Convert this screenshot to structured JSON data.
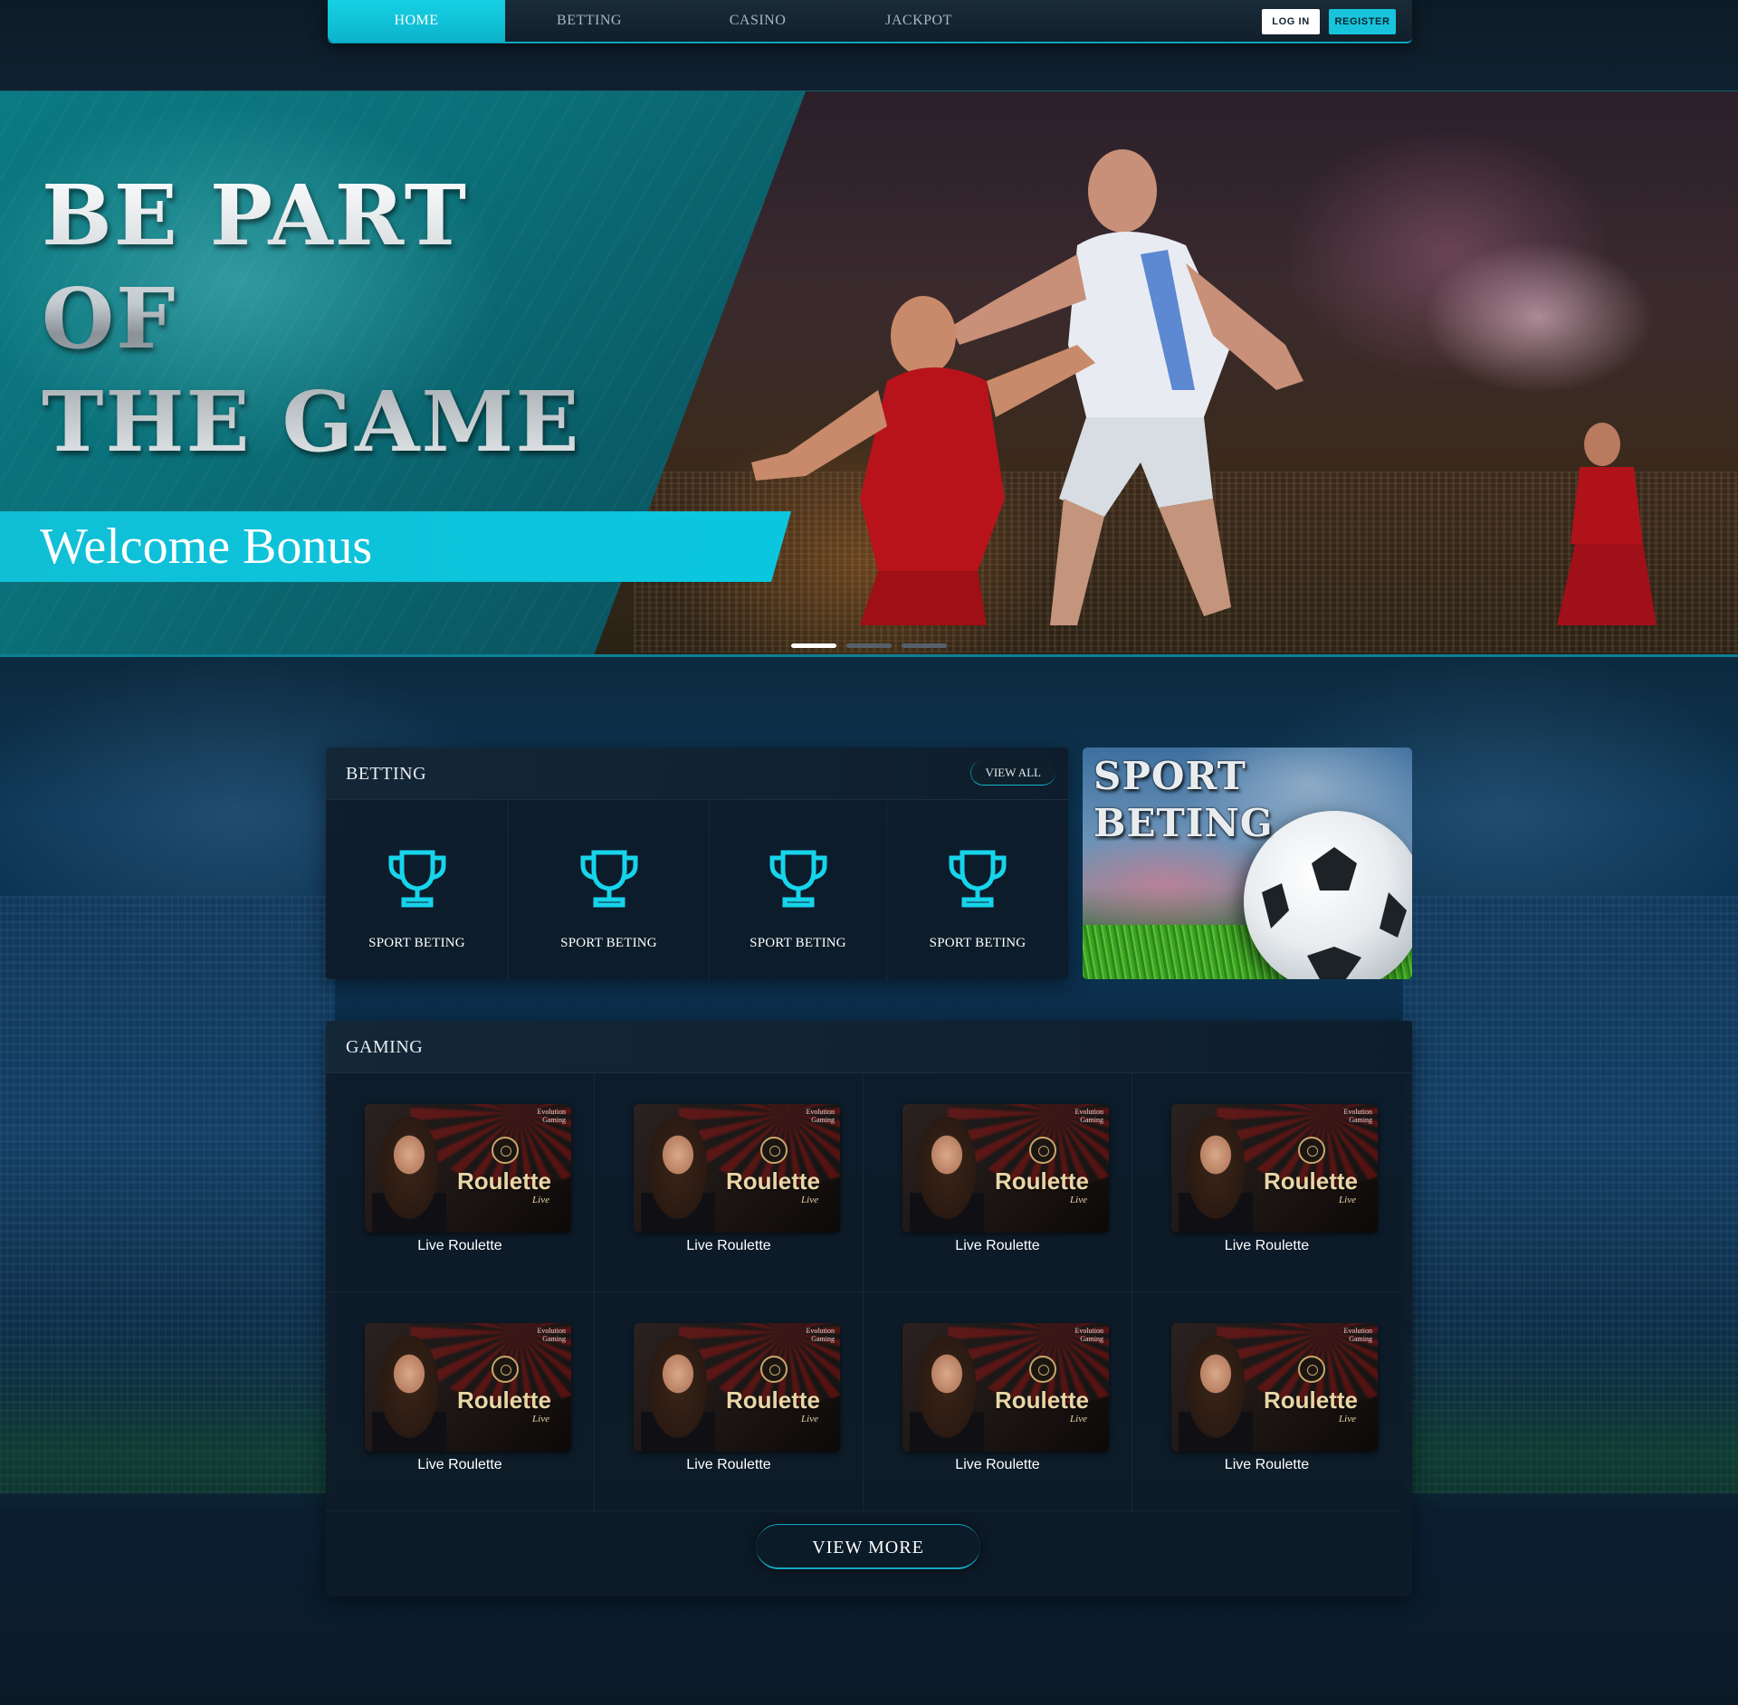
{
  "nav": {
    "items": [
      {
        "label": "HOME",
        "active": true
      },
      {
        "label": "BETTING",
        "active": false
      },
      {
        "label": "CASINO",
        "active": false
      },
      {
        "label": "JACKPOT",
        "active": false
      }
    ],
    "login_label": "LOG IN",
    "register_label": "REGISTER"
  },
  "hero": {
    "title_lines": [
      "BE PART",
      "OF",
      "THE GAME"
    ],
    "subtitle": "Welcome Bonus",
    "slides": 3,
    "active_slide": 1
  },
  "betting": {
    "title": "BETTING",
    "view_all_label": "VIEW ALL",
    "items": [
      {
        "label": "SPORT BETING",
        "icon": "trophy-icon"
      },
      {
        "label": "SPORT BETING",
        "icon": "trophy-icon"
      },
      {
        "label": "SPORT BETING",
        "icon": "trophy-icon"
      },
      {
        "label": "SPORT BETING",
        "icon": "trophy-icon"
      }
    ]
  },
  "promo": {
    "title_lines": [
      "SPORT",
      "BETING"
    ]
  },
  "gaming": {
    "title": "GAMING",
    "items": [
      {
        "label": "Live Roulette",
        "thumb_title": "Roulette",
        "thumb_sub": "Live",
        "brand": "Evolution Gaming"
      },
      {
        "label": "Live Roulette",
        "thumb_title": "Roulette",
        "thumb_sub": "Live",
        "brand": "Evolution Gaming"
      },
      {
        "label": "Live Roulette",
        "thumb_title": "Roulette",
        "thumb_sub": "Live",
        "brand": "Evolution Gaming"
      },
      {
        "label": "Live Roulette",
        "thumb_title": "Roulette",
        "thumb_sub": "Live",
        "brand": "Evolution Gaming"
      },
      {
        "label": "Live Roulette",
        "thumb_title": "Roulette",
        "thumb_sub": "Live",
        "brand": "Evolution Gaming"
      },
      {
        "label": "Live Roulette",
        "thumb_title": "Roulette",
        "thumb_sub": "Live",
        "brand": "Evolution Gaming"
      },
      {
        "label": "Live Roulette",
        "thumb_title": "Roulette",
        "thumb_sub": "Live",
        "brand": "Evolution Gaming"
      },
      {
        "label": "Live Roulette",
        "thumb_title": "Roulette",
        "thumb_sub": "Live",
        "brand": "Evolution Gaming"
      }
    ],
    "view_more_label": "VIEW MORE"
  },
  "colors": {
    "accent": "#0fc2da",
    "panel": "#0e1b28",
    "hero_teal": "#0b6f78"
  }
}
